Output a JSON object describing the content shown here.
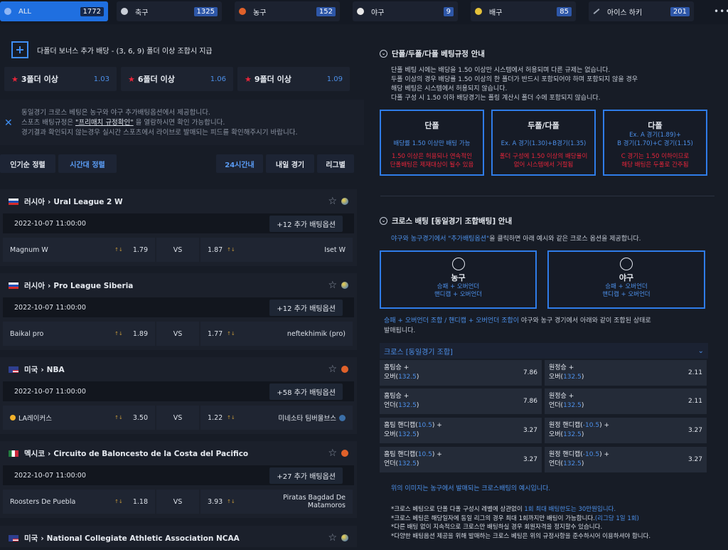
{
  "sports": [
    {
      "label": "ALL",
      "count": "1772",
      "icon": "all-icon",
      "active": true
    },
    {
      "label": "축구",
      "count": "1325",
      "icon": "soccer-icon"
    },
    {
      "label": "농구",
      "count": "152",
      "icon": "basketball-icon"
    },
    {
      "label": "야구",
      "count": "9",
      "icon": "baseball-icon"
    },
    {
      "label": "배구",
      "count": "85",
      "icon": "volleyball-icon"
    },
    {
      "label": "아이스 하키",
      "count": "201",
      "icon": "hockey-icon"
    }
  ],
  "bonus": {
    "title": "다폴더 보너스 추가 배당 - (3, 6, 9) 폴더 이상 조합시 지급",
    "items": [
      {
        "label": "3폴더 이상",
        "odds": "1.03"
      },
      {
        "label": "6폴더 이상",
        "odds": "1.06"
      },
      {
        "label": "9폴더 이상",
        "odds": "1.09"
      }
    ]
  },
  "notice": {
    "line1": "동일경기 크로스 베팅은 농구와 야구 추가배팅옵션에서 제공합니다.",
    "line2_pre": "스포츠 배팅규정은 ",
    "line2_link": "\"프리매치 규정확인\"",
    "line2_post": " 을 열람하시면 확인 가능합니다.",
    "line3": "경기결과 확인되지 않는경우 실시간 스포츠에서 라이브로 발매되는 피드를 확인해주시기 바랍니다."
  },
  "sort": {
    "popular": "인기순 정렬",
    "time": "시간대 정렬",
    "h24": "24시간내",
    "tomorrow": "내일 경기",
    "league": "리그별"
  },
  "matches": [
    {
      "country": "러시아",
      "league": "Ural League 2 W",
      "date": "2022-10-07 11:00:00",
      "options": "+12 추가 배팅옵션",
      "home": "Magnum W",
      "home_odds": "1.79",
      "away": "Iset W",
      "away_odds": "1.87",
      "vs": "VS"
    },
    {
      "country": "러시아",
      "league": "Pro League Siberia",
      "date": "2022-10-07 11:00:00",
      "options": "+12 추가 배팅옵션",
      "home": "Baikal pro",
      "home_odds": "1.89",
      "away": "neftekhimik (pro)",
      "away_odds": "1.77",
      "vs": "VS"
    },
    {
      "country": "미국",
      "league": "NBA",
      "date": "2022-10-07 11:00:00",
      "options": "+58 추가 배팅옵션",
      "home": "LA레이커스",
      "home_odds": "3.50",
      "away": "미네소타 팀버울브스",
      "away_odds": "1.22",
      "vs": "VS"
    },
    {
      "country": "멕시코",
      "league": "Circuito de Baloncesto de la Costa del Pacifico",
      "date": "2022-10-07 11:00:00",
      "options": "+27 추가 배팅옵션",
      "home": "Roosters De Puebla",
      "home_odds": "1.18",
      "away": "Piratas Bagdad De Matamoros",
      "away_odds": "3.93",
      "vs": "VS"
    },
    {
      "country": "미국",
      "league": "National Collegiate Athletic Association NCAA"
    }
  ],
  "rules": {
    "title": "단폴/두폴/다폴 베팅규정 안내",
    "lines": [
      "단폴 베팅 시에는 배당을 1.50 이상만 시스템에서 허용되며 다른 규제는 없습니다.",
      "두폴 이상의 경우 배당률 1.50 이상의 한 폴더가 반드시 포함되어야 하며 포함되지 않을 경우",
      "해당 베팅은 시스템에서 허용되지 않습니다.",
      "다폴 구성 시 1.50 이하 배당경기는 폴링 계산시 폴더 수에 포함되지 않습니다."
    ],
    "boxes": [
      {
        "title": "단폴",
        "blue": [
          "배당률 1.50 이상만 배팅 가능"
        ],
        "red": [
          "1.50 이상은 허용되나 연속적인",
          "단폴배팅은 제재대상이 될수 있음"
        ]
      },
      {
        "title": "두폴/다폴",
        "blue": [
          "Ex. A 경기(1.30)+B경기(1.35)"
        ],
        "red": [
          "폴더 구성에 1.50 이상의 배당율이",
          "없어 시스템에서 거절됨"
        ]
      },
      {
        "title": "다폴",
        "blue": [
          "Ex. A 경기(1.89)+",
          "B 경기(1.70)+C 경기(1.15)"
        ],
        "red": [
          "C 경기는 1.50 이하이므로",
          "해당 배팅은 두폴로 간주됨"
        ]
      }
    ]
  },
  "cross": {
    "title": "크로스 배팅 [동일경기 조합배팅] 안내",
    "desc_pre": "야구와 농구경기에서 \"추가배팅옵션\"",
    "desc_post": "을 클릭하면 아래 예시와 같은 크로스 옵션을 제공합니다.",
    "boxes": [
      {
        "title": "농구",
        "l1": "승패 + 오버언더",
        "l2": "핸디캡 + 오버언더"
      },
      {
        "title": "야구",
        "l1": "승패 + 오버언더",
        "l2": "핸디캡 + 오버언더"
      }
    ],
    "combo_blue": "승패 + 오버언더 조합 / 핸디캡 + 오버언더 조합이",
    "combo_white": " 야구와 농구 경기에서 아래와 같이 조합된 상태로",
    "combo_line2": "발매됩니다.",
    "bar": "크로스 [동일경기 조합]",
    "cells": [
      {
        "a": "홈팀승 +",
        "b": "오버(",
        "n": "132.5",
        ")": ")",
        "odds": "7.86"
      },
      {
        "a": "원정승 +",
        "b": "오버(",
        "n": "132.5",
        "odds": "2.11"
      },
      {
        "a": "홈팀승 +",
        "b": "언더(",
        "n": "132.5",
        "odds": "7.86"
      },
      {
        "a": "원정승 +",
        "b": "언더(",
        "n": "132.5",
        "odds": "2.11"
      },
      {
        "a": "홈팀 핸디캡(",
        "an": "10.5",
        "a2": ") +",
        "b": "오버(",
        "n": "132.5",
        "odds": "3.27"
      },
      {
        "a": "원정 핸디캡(",
        "an": "-10.5",
        "a2": ") +",
        "b": "오버(",
        "n": "132.5",
        "odds": "3.27"
      },
      {
        "a": "홈팀 핸디캡(",
        "an": "10.5",
        "a2": ") +",
        "b": "언더(",
        "n": "132.5",
        "odds": "3.27"
      },
      {
        "a": "원정 핸디캡(",
        "an": "-10.5",
        "a2": ") +",
        "b": "언더(",
        "n": "132.5",
        "odds": "3.27"
      }
    ],
    "foot1": "위의 이미지는 농구에서 발매되는 크로스배팅의 예시입니다.",
    "foot_lines": [
      {
        "w": "*크로스 베팅으로 단폴 다폴 구성시 레벨에 상관없이 ",
        "b": "1회 최대 배팅한도는 30만원입니다."
      },
      {
        "w": "*크로스 베팅은 해당일자에 동일 리그의 경우 최대 1회까지만 배팅이 가능합니다.",
        "b": "(리그당 1일 1회)"
      },
      {
        "w": "*다른 배팅 없이 지속적으로 크로스만 배팅하실 경우 회원자격을 정지할수 있습니다.",
        "b": ""
      },
      {
        "w": "*다양한 배팅옵션 제공을 위해 발매하는 크로스 베팅은 위의 규정사항을 준수하시어 이용하셔야 합니다.",
        "b": ""
      }
    ]
  }
}
